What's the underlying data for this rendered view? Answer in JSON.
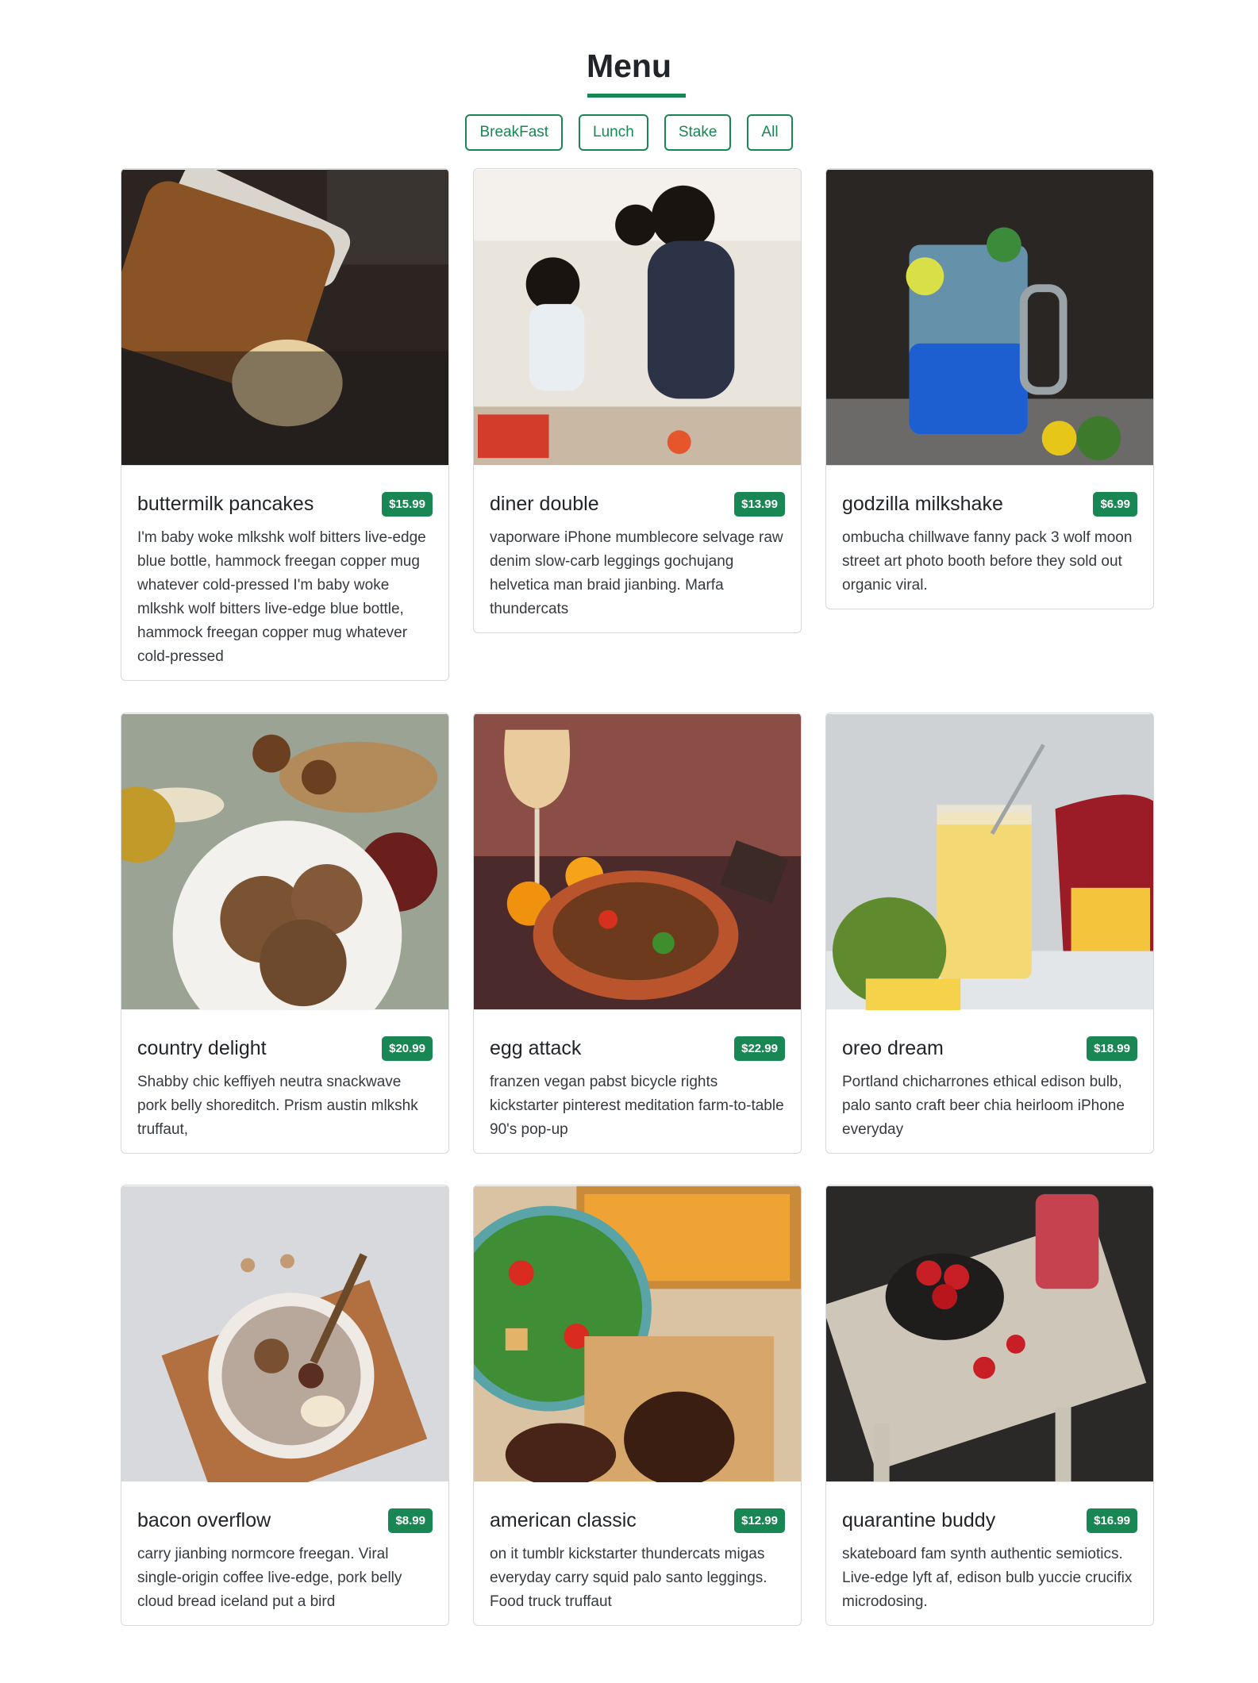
{
  "page": {
    "title": "Menu"
  },
  "filters": [
    "BreakFast",
    "Lunch",
    "Stake",
    "All"
  ],
  "colors": {
    "accent": "#198754"
  },
  "items": [
    {
      "title": "buttermilk pancakes",
      "price": "$15.99",
      "desc": "I'm baby woke mlkshk wolf bitters live-edge blue bottle, hammock freegan copper mug whatever cold-pressed I'm baby woke mlkshk wolf bitters live-edge blue bottle, hammock freegan copper mug whatever cold-pressed"
    },
    {
      "title": "diner double",
      "price": "$13.99",
      "desc": "vaporware iPhone mumblecore selvage raw denim slow-carb leggings gochujang helvetica man braid jianbing. Marfa thundercats"
    },
    {
      "title": "godzilla milkshake",
      "price": "$6.99",
      "desc": "ombucha chillwave fanny pack 3 wolf moon street art photo booth before they sold out organic viral."
    },
    {
      "title": "country delight",
      "price": "$20.99",
      "desc": "Shabby chic keffiyeh neutra snackwave pork belly shoreditch. Prism austin mlkshk truffaut,"
    },
    {
      "title": "egg attack",
      "price": "$22.99",
      "desc": "franzen vegan pabst bicycle rights kickstarter pinterest meditation farm-to-table 90's pop-up"
    },
    {
      "title": "oreo dream",
      "price": "$18.99",
      "desc": "Portland chicharrones ethical edison bulb, palo santo craft beer chia heirloom iPhone everyday"
    },
    {
      "title": "bacon overflow",
      "price": "$8.99",
      "desc": "carry jianbing normcore freegan. Viral single-origin coffee live-edge, pork belly cloud bread iceland put a bird"
    },
    {
      "title": "american classic",
      "price": "$12.99",
      "desc": "on it tumblr kickstarter thundercats migas everyday carry squid palo santo leggings. Food truck truffaut"
    },
    {
      "title": "quarantine buddy",
      "price": "$16.99",
      "desc": "skateboard fam synth authentic semiotics. Live-edge lyft af, edison bulb yuccie crucifix microdosing."
    }
  ]
}
